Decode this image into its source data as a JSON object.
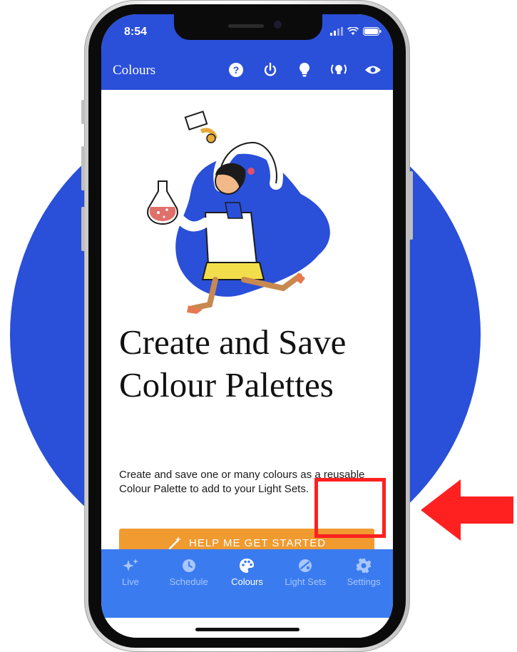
{
  "status_bar": {
    "time": "8:54"
  },
  "app_bar": {
    "title": "Colours",
    "icons": [
      "help-icon",
      "power-icon",
      "bulb-icon",
      "broadcast-icon",
      "eye-icon"
    ]
  },
  "content": {
    "headline": "Create and Save Colour Palettes",
    "description": "Create and save one or many colours as a reusable Colour Palette to add to your Light Sets.",
    "cta_label": "HELP ME GET STARTED",
    "fab_label": "+"
  },
  "tabs": [
    {
      "label": "Live",
      "icon": "sparkle-icon",
      "active": false
    },
    {
      "label": "Schedule",
      "icon": "schedule-icon",
      "active": false
    },
    {
      "label": "Colours",
      "icon": "palette-icon",
      "active": true
    },
    {
      "label": "Light Sets",
      "icon": "light-sets-icon",
      "active": false
    },
    {
      "label": "Settings",
      "icon": "settings-icon",
      "active": false
    }
  ],
  "colors": {
    "brand_blue": "#2a4fd8",
    "tab_blue": "#3a7bf0",
    "accent_orange": "#f09a30",
    "annotation_red": "#ff2020"
  }
}
